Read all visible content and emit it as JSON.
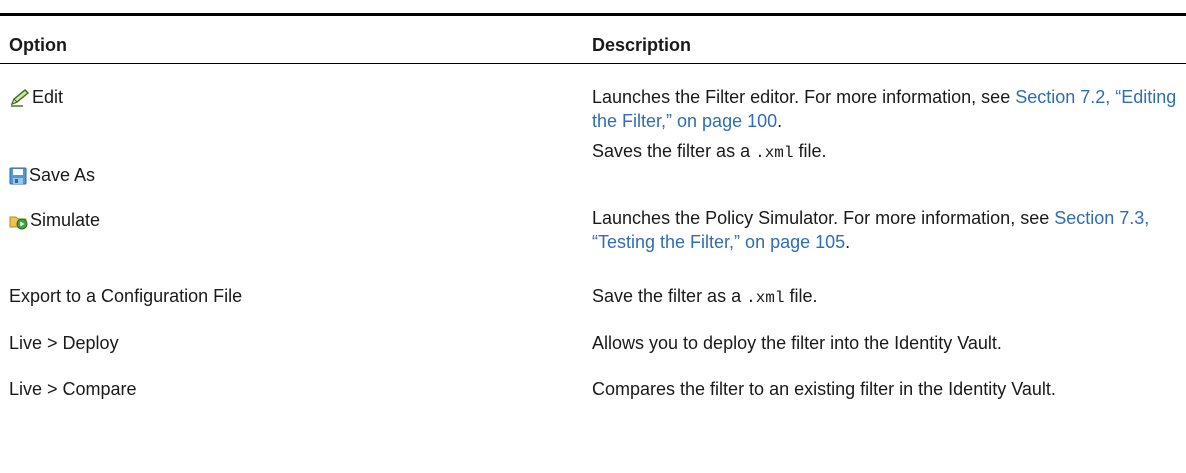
{
  "header": {
    "option": "Option",
    "description": "Description"
  },
  "rows": [
    {
      "option": "Edit",
      "icon": "pencil-icon",
      "desc_before": "Launches the Filter editor. For more information, see ",
      "desc_link": "Section 7.2, “Editing the Filter,” on page 100",
      "desc_after": "."
    },
    {
      "option": "Save As",
      "icon": "save-icon",
      "desc_before": "Saves the filter as a ",
      "desc_code": ".xml",
      "desc_after": " file."
    },
    {
      "option": "Simulate",
      "icon": "simulate-icon",
      "desc_before": "Launches the Policy Simulator. For more information, see ",
      "desc_link": "Section 7.3, “Testing the Filter,” on page 105",
      "desc_after": "."
    },
    {
      "option": "Export to a Configuration File",
      "desc_before": "Save the filter as a ",
      "desc_code": ".xml",
      "desc_after": " file."
    },
    {
      "option": "Live > Deploy",
      "desc": "Allows you to deploy the filter into the Identity Vault."
    },
    {
      "option": "Live > Compare",
      "desc": "Compares the filter to an existing filter in the Identity Vault."
    }
  ]
}
